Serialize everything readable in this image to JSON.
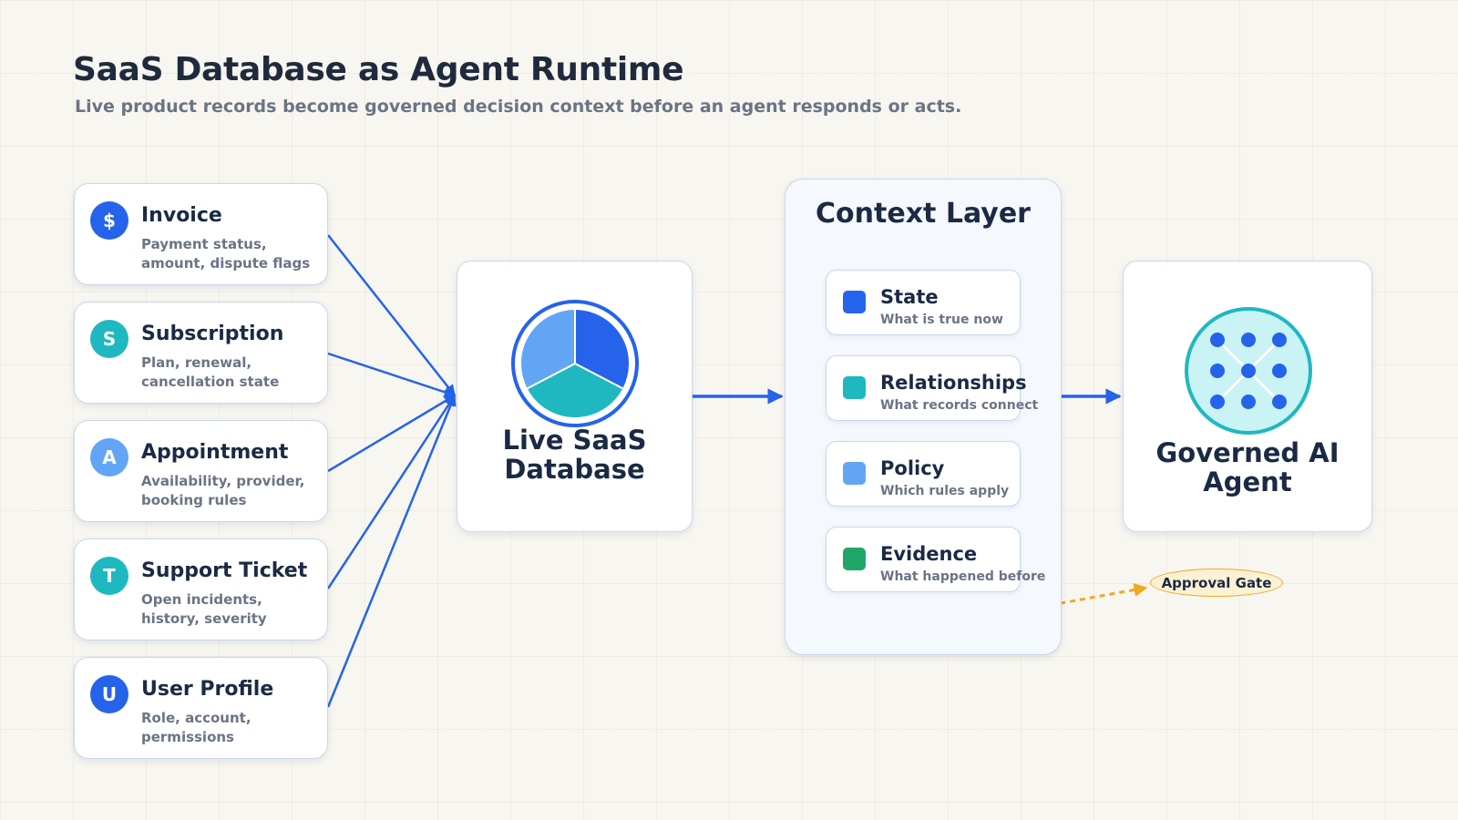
{
  "header": {
    "title": "SaaS Database as Agent Runtime",
    "subtitle": "Live product records become governed decision context before an agent responds or acts."
  },
  "sources": [
    {
      "badge": "$",
      "title": "Invoice",
      "desc": "Payment status, amount, dispute flags",
      "color": "#2563eb"
    },
    {
      "badge": "S",
      "title": "Subscription",
      "desc": "Plan, renewal, cancellation state",
      "color": "#1fb8c0"
    },
    {
      "badge": "A",
      "title": "Appointment",
      "desc": "Availability, provider, booking rules",
      "color": "#62a5f5"
    },
    {
      "badge": "T",
      "title": "Support Ticket",
      "desc": "Open incidents, history, severity",
      "color": "#1fb8c0"
    },
    {
      "badge": "U",
      "title": "User Profile",
      "desc": "Role, account, permissions",
      "color": "#2563eb"
    }
  ],
  "database": {
    "title": "Live SaaS Database",
    "icon": "pie-chart-icon",
    "slice_colors": [
      "#2563eb",
      "#1fb8c0",
      "#62a5f5"
    ]
  },
  "context_layer": {
    "title": "Context Layer",
    "items": [
      {
        "title": "State",
        "desc": "What is true now",
        "color": "#2563eb"
      },
      {
        "title": "Relationships",
        "desc": "What records connect",
        "color": "#1fb8c0"
      },
      {
        "title": "Policy",
        "desc": "Which rules apply",
        "color": "#62a5f5"
      },
      {
        "title": "Evidence",
        "desc": "What happened before",
        "color": "#21a66a"
      }
    ]
  },
  "agent": {
    "title": "Governed AI Agent",
    "icon": "network-node-icon",
    "ring_color": "#1fb8c0",
    "fill_color": "#c9f3f4",
    "dot_color": "#2563eb"
  },
  "approval_gate": {
    "label": "Approval Gate",
    "color": "#f0a827"
  },
  "colors": {
    "arrow": "#2563eb",
    "text": "#1b2a44",
    "muted": "#6b7485",
    "border": "#c6d8ee"
  }
}
